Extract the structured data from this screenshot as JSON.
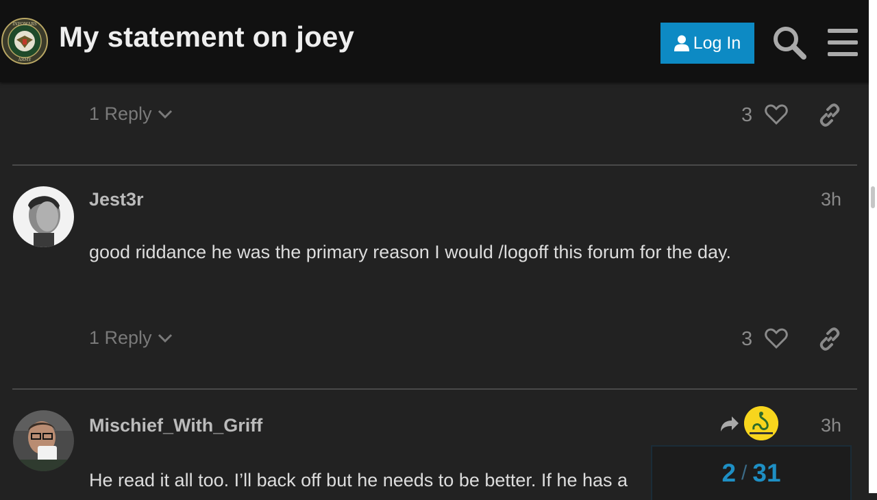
{
  "header": {
    "title": "My statement on joey",
    "login_label": "Log In",
    "logo_icon": "infowars-army-logo-icon",
    "accent_color": "#0d8ac4"
  },
  "posts": [
    {
      "reply_label": "1 Reply",
      "likes": "3"
    },
    {
      "username": "Jest3r",
      "date": "3h",
      "body": "good riddance he was the primary reason I would /logoff this forum for the day.",
      "reply_label": "1 Reply",
      "likes": "3"
    },
    {
      "username": "Mischief_With_Griff",
      "date": "3h",
      "body": "He read it all too. I’ll back off but he needs to be better. If he has a",
      "flair_icon": "gadsden-flag-flair-icon"
    }
  ],
  "progress": {
    "current": "2",
    "separator": "/",
    "total": "31"
  }
}
